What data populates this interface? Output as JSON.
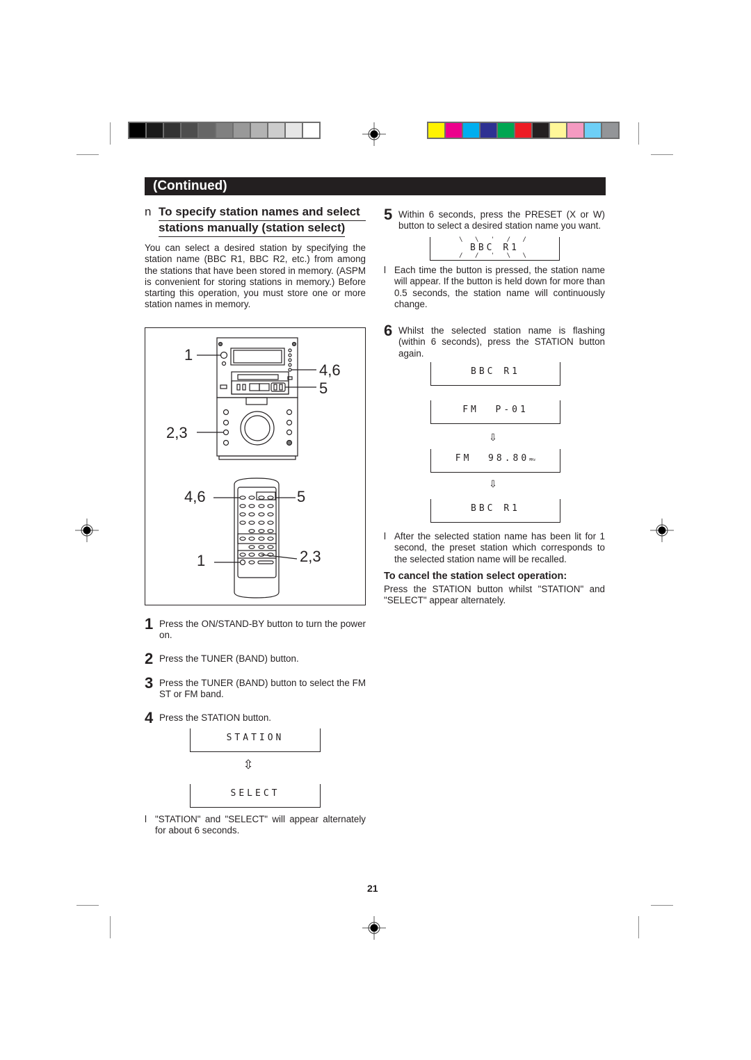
{
  "print_marks": {
    "grayscale_swatches": [
      "#000000",
      "#1a1a1a",
      "#333333",
      "#4d4d4d",
      "#666666",
      "#808080",
      "#999999",
      "#b3b3b3",
      "#cccccc",
      "#e6e6e6",
      "#ffffff"
    ],
    "color_swatches": [
      "#fff200",
      "#ec008c",
      "#00aeef",
      "#2e3192",
      "#00a651",
      "#ed1c24",
      "#231f20",
      "#fff799",
      "#f49ac1",
      "#6dcff6",
      "#939598"
    ]
  },
  "header": {
    "title": "(Continued)"
  },
  "section": {
    "bullet": "n",
    "title_line1": "To specify station names and select",
    "title_line2": "stations manually (station select)",
    "intro": "You can select a desired station by specifying the station name (BBC R1, BBC R2, etc.) from among the stations that have been stored in memory. (ASPM is convenient for storing stations in memory.) Before starting this operation, you must store one or more station names in memory."
  },
  "figure": {
    "unit_callouts": {
      "power": "1",
      "station": "4,6",
      "preset": "5",
      "tuner": "2,3"
    },
    "remote_callouts": {
      "station": "4,6",
      "preset": "5",
      "power": "1",
      "tuner": "2,3"
    }
  },
  "steps": [
    {
      "num": "1",
      "text": "Press the ON/STAND-BY button to turn the power on."
    },
    {
      "num": "2",
      "text": "Press the TUNER (BAND) button."
    },
    {
      "num": "3",
      "text": "Press the TUNER (BAND) button to select the FM ST or FM band."
    },
    {
      "num": "4",
      "text": "Press the STATION button."
    },
    {
      "num": "5",
      "text": "Within 6 seconds, press the PRESET (X  or W) button to select a desired station name you want."
    },
    {
      "num": "6",
      "text": "Whilst the selected station name is flashing (within 6 seconds), press the STATION button again."
    }
  ],
  "displays": {
    "station": "STATION",
    "select": "SELECT",
    "bbc_flashing": "BBC R1",
    "bbc": "BBC R1",
    "fm_preset": "FM  P-01",
    "fm_freq": "FM  98.80",
    "fm_freq_unit": "MHz",
    "bbc_final": "BBC R1"
  },
  "notes": {
    "mark": "l",
    "alternate": "\"STATION\" and \"SELECT\" will appear alternately for about 6 seconds.",
    "each_time": "Each time the button is pressed, the station name will appear. If the button is held down for more than 0.5 seconds, the station name will continuously change.",
    "after": "After the selected station name has been lit for 1 second, the preset station which corresponds to the selected station name will be recalled."
  },
  "cancel": {
    "title": "To cancel the station select operation:",
    "text": "Press the STATION button whilst \"STATION\" and \"SELECT\" appear alternately."
  },
  "page_number": "21"
}
